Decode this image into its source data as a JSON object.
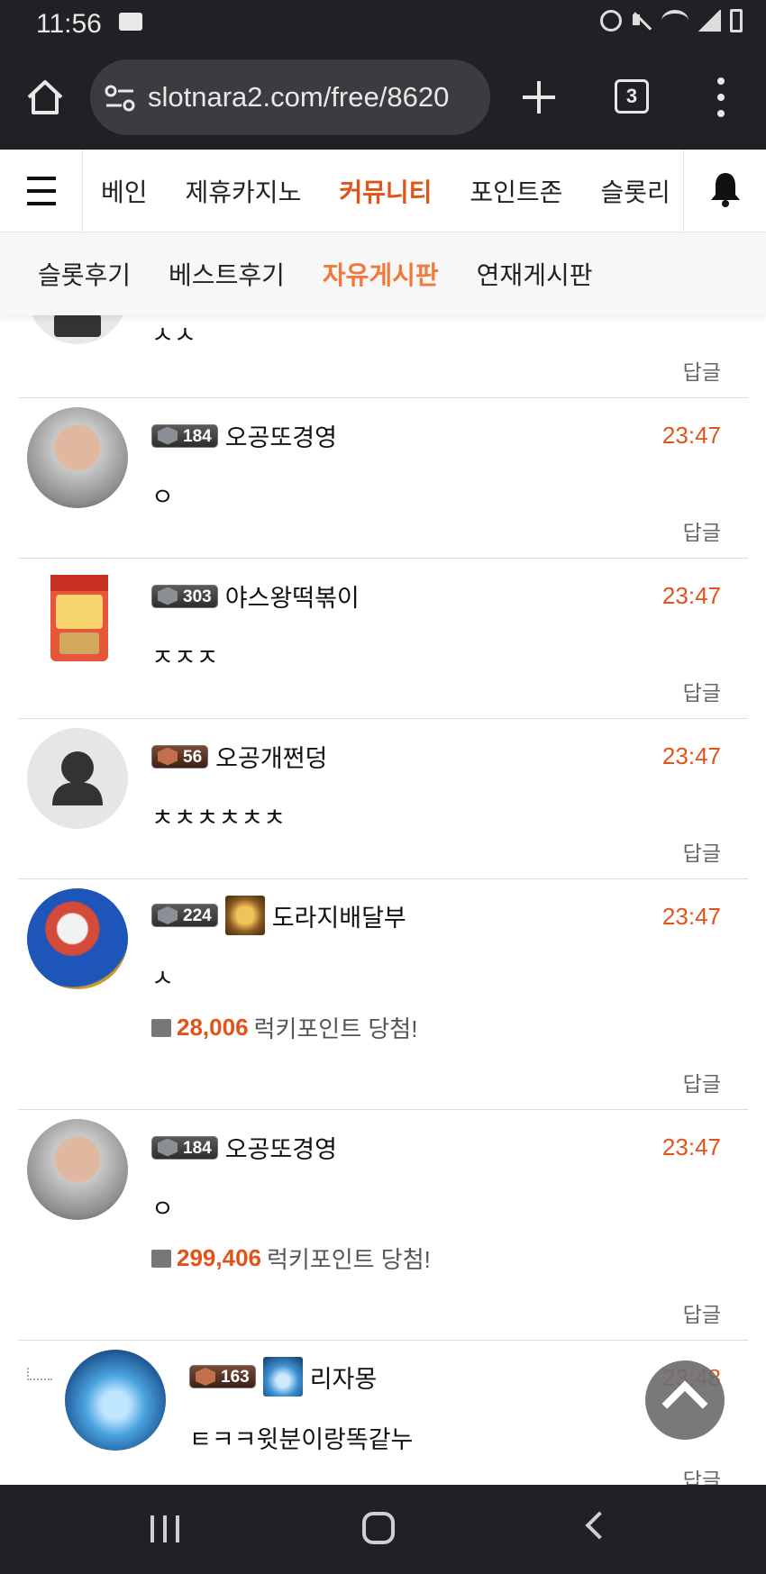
{
  "status_bar": {
    "time": "11:56"
  },
  "browser": {
    "url": "slotnara2.com/free/8620",
    "tab_count": "3"
  },
  "site_nav": {
    "items": [
      {
        "label": "베인",
        "active": false
      },
      {
        "label": "제휴카지노",
        "active": false
      },
      {
        "label": "커뮤니티",
        "active": true
      },
      {
        "label": "포인트존",
        "active": false
      },
      {
        "label": "슬롯리",
        "active": false
      }
    ]
  },
  "sub_nav": {
    "items": [
      {
        "label": "슬롯후기",
        "active": false
      },
      {
        "label": "베스트후기",
        "active": false
      },
      {
        "label": "자유게시판",
        "active": true
      },
      {
        "label": "연재게시판",
        "active": false
      }
    ]
  },
  "reply_label": "답글",
  "lucky_suffix": "럭키포인트 당첨!",
  "comments": [
    {
      "partial": true,
      "text": "ㅅㅅ"
    },
    {
      "level": "184",
      "nickname": "오공또경영",
      "time": "23:47",
      "text": "ㅇ"
    },
    {
      "level": "303",
      "nickname": "야스왕떡볶이",
      "time": "23:47",
      "text": "ㅈㅈㅈ"
    },
    {
      "level": "56",
      "nickname": "오공개쩐덩",
      "time": "23:47",
      "text": "ㅊㅊㅊㅊㅊㅊ"
    },
    {
      "level": "224",
      "nickname": "도라지배달부",
      "time": "23:47",
      "text": "ㅅ",
      "lucky_amount": "28,006"
    },
    {
      "level": "184",
      "nickname": "오공또경영",
      "time": "23:47",
      "text": "ㅇ",
      "lucky_amount": "299,406"
    },
    {
      "level": "163",
      "nickname": "리자몽",
      "time": "23:48",
      "text": "ㅌㅋㅋ윗분이랑똑같누",
      "is_reply": true
    }
  ],
  "colors": {
    "accent": "#e2531a",
    "sub_accent": "#f07a3c",
    "chrome_dark": "#202124"
  }
}
